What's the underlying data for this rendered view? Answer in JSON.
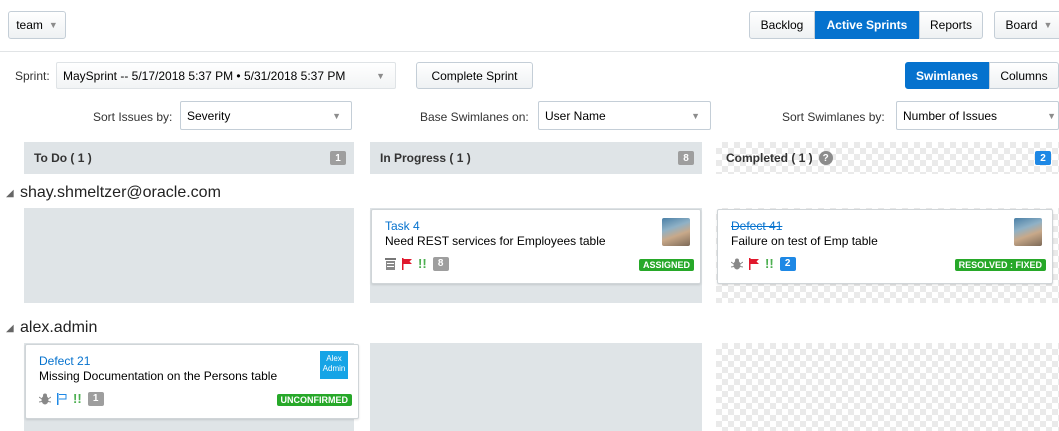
{
  "header": {
    "team_label": "team",
    "nav": [
      "Backlog",
      "Active Sprints",
      "Reports"
    ],
    "board_label": "Board"
  },
  "sprint": {
    "label": "Sprint:",
    "value": "MaySprint -- 5/17/2018 5:37 PM • 5/31/2018 5:37 PM",
    "complete_label": "Complete Sprint",
    "view_toggle": [
      "Swimlanes",
      "Columns"
    ]
  },
  "sort": {
    "issues_label": "Sort Issues by:",
    "issues_value": "Severity",
    "base_label": "Base Swimlanes on:",
    "base_value": "User Name",
    "swim_label": "Sort Swimlanes by:",
    "swim_value": "Number of Issues"
  },
  "columns": [
    {
      "title": "To Do ( 1 )",
      "count": "1"
    },
    {
      "title": "In Progress ( 1 )",
      "count": "8"
    },
    {
      "title": "Completed ( 1 )",
      "count": "2"
    }
  ],
  "help_glyph": "?",
  "lanes": [
    {
      "name": "shay.shmeltzer@oracle.com",
      "cards": [
        {
          "id": "Task 4",
          "summary": "Need REST services for Employees table",
          "count": "8",
          "status": "ASSIGNED",
          "type_icon": "task-icon"
        },
        {
          "id": "Defect 41",
          "summary": "Failure on test of Emp table",
          "count": "2",
          "status": "RESOLVED : FIXED",
          "type_icon": "bug-icon"
        }
      ]
    },
    {
      "name": "alex.admin",
      "cards": [
        {
          "id": "Defect 21",
          "summary": "Missing Documentation on the Persons table",
          "count": "1",
          "status": "UNCONFIRMED",
          "type_icon": "bug-icon",
          "avatar_text": "Alex Admin"
        }
      ]
    }
  ],
  "glyphs": {
    "lane_toggle": "◢",
    "priority": "!!"
  },
  "colors": {
    "accent": "#0572ce",
    "status_green": "#27a829",
    "count_blue": "#1e88e5",
    "header_gray": "#dfe4e7"
  }
}
